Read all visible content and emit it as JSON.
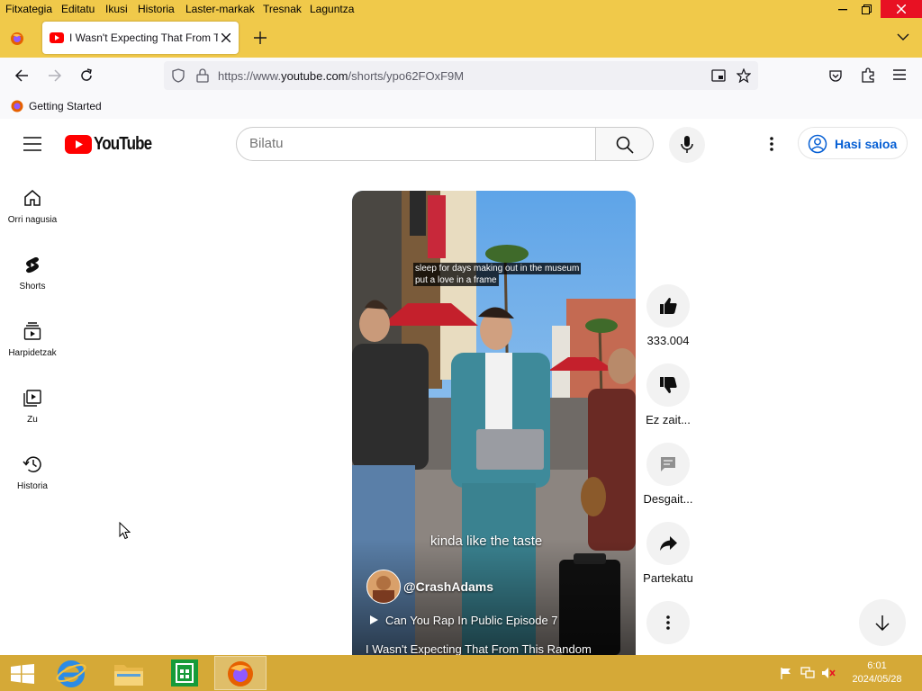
{
  "menu": [
    "Fitxategia",
    "Editatu",
    "Ikusi",
    "Historia",
    "Laster-markak",
    "Tresnak",
    "Laguntza"
  ],
  "tab": {
    "title": "I Wasn't Expecting That From This Random"
  },
  "nav": {
    "url_prefix": "https://www.",
    "url_domain": "youtube.com",
    "url_path": "/shorts/ypo62FOxF9M"
  },
  "bookmarks": {
    "getting_started": "Getting Started"
  },
  "yt": {
    "logo_text": "YouTube",
    "search_placeholder": "Bilatu",
    "signin_label": "Hasi saioa"
  },
  "sidebar": [
    {
      "label": "Orri nagusia",
      "icon": "home-icon"
    },
    {
      "label": "Shorts",
      "icon": "shorts-icon"
    },
    {
      "label": "Harpidetzak",
      "icon": "subscriptions-icon"
    },
    {
      "label": "Zu",
      "icon": "you-icon"
    },
    {
      "label": "Historia",
      "icon": "history-icon"
    }
  ],
  "video": {
    "caption_line1": "sleep for days making out in the museum",
    "caption_line2": "put a love in a frame",
    "lyric": "kinda like the taste",
    "channel": "@CrashAdams",
    "playlist": "Can You Rap In Public Episode 7",
    "title": "I Wasn't Expecting That From This Random"
  },
  "actions": {
    "like_count": "333.004",
    "dislike_label": "Ez zait...",
    "comments_label": "Desgait...",
    "share_label": "Partekatu"
  },
  "taskbar": {
    "time": "6:01",
    "date": "2024/05/28"
  },
  "colors": {
    "accent": "#f0c94a",
    "youtube_red": "#ff0000",
    "signin_blue": "#065fd4",
    "taskbar": "#d5a937"
  }
}
